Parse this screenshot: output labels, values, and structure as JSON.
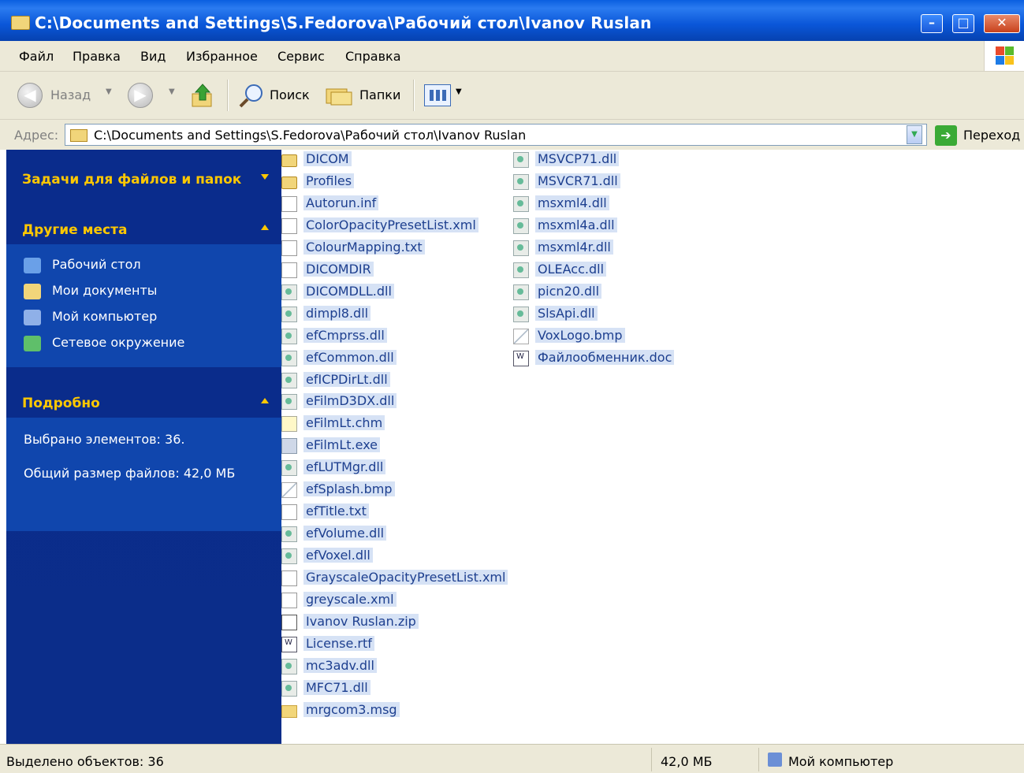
{
  "window": {
    "title": "C:\\Documents and Settings\\S.Fedorova\\Рабочий стол\\Ivanov Ruslan"
  },
  "menu": [
    "Файл",
    "Правка",
    "Вид",
    "Избранное",
    "Сервис",
    "Справка"
  ],
  "toolbar": {
    "back_label": "Назад",
    "search_label": "Поиск",
    "folders_label": "Папки"
  },
  "address": {
    "label": "Адрес:",
    "value": "C:\\Documents and Settings\\S.Fedorova\\Рабочий стол\\Ivanov Ruslan",
    "go_label": "Переход"
  },
  "sidebar": {
    "tasks_title": "Задачи для файлов и папок",
    "places_title": "Другие места",
    "places": [
      "Рабочий стол",
      "Мои документы",
      "Мой компьютер",
      "Сетевое окружение"
    ],
    "details_title": "Подробно",
    "selected_count": "Выбрано элементов: 36.",
    "total_size": "Общий размер файлов: 42,0 МБ"
  },
  "files": [
    {
      "name": "DICOM",
      "icon": "folder-icon"
    },
    {
      "name": "Profiles",
      "icon": "folder-icon"
    },
    {
      "name": "Autorun.inf",
      "icon": "inf-file-icon"
    },
    {
      "name": "ColorOpacityPresetList.xml",
      "icon": "xml-file-icon"
    },
    {
      "name": "ColourMapping.txt",
      "icon": "text-file-icon"
    },
    {
      "name": "DICOMDIR",
      "icon": "generic-file-icon"
    },
    {
      "name": "DICOMDLL.dll",
      "icon": "dll-file-icon"
    },
    {
      "name": "dimpl8.dll",
      "icon": "dll-file-icon"
    },
    {
      "name": "efCmprss.dll",
      "icon": "dll-file-icon"
    },
    {
      "name": "efCommon.dll",
      "icon": "dll-file-icon"
    },
    {
      "name": "efICPDirLt.dll",
      "icon": "dll-file-icon"
    },
    {
      "name": "eFilmD3DX.dll",
      "icon": "dll-file-icon"
    },
    {
      "name": "eFilmLt.chm",
      "icon": "help-file-icon"
    },
    {
      "name": "eFilmLt.exe",
      "icon": "exe-file-icon"
    },
    {
      "name": "efLUTMgr.dll",
      "icon": "dll-file-icon"
    },
    {
      "name": "efSplash.bmp",
      "icon": "bmp-file-icon"
    },
    {
      "name": "efTitle.txt",
      "icon": "text-file-icon"
    },
    {
      "name": "efVolume.dll",
      "icon": "dll-file-icon"
    },
    {
      "name": "efVoxel.dll",
      "icon": "dll-file-icon"
    },
    {
      "name": "GrayscaleOpacityPresetList.xml",
      "icon": "xml-file-icon"
    },
    {
      "name": "greyscale.xml",
      "icon": "xml-file-icon"
    },
    {
      "name": "Ivanov Ruslan.zip",
      "icon": "zip-file-icon"
    },
    {
      "name": "License.rtf",
      "icon": "rtf-file-icon"
    },
    {
      "name": "mc3adv.dll",
      "icon": "dll-file-icon"
    },
    {
      "name": "MFC71.dll",
      "icon": "dll-file-icon"
    },
    {
      "name": "mrgcom3.msg",
      "icon": "msg-file-icon"
    },
    {
      "name": "MSVCP71.dll",
      "icon": "dll-file-icon"
    },
    {
      "name": "MSVCR71.dll",
      "icon": "dll-file-icon"
    },
    {
      "name": "msxml4.dll",
      "icon": "dll-file-icon"
    },
    {
      "name": "msxml4a.dll",
      "icon": "dll-file-icon"
    },
    {
      "name": "msxml4r.dll",
      "icon": "dll-file-icon"
    },
    {
      "name": "OLEAcc.dll",
      "icon": "dll-file-icon"
    },
    {
      "name": "picn20.dll",
      "icon": "dll-file-icon"
    },
    {
      "name": "SlsApi.dll",
      "icon": "dll-file-icon"
    },
    {
      "name": "VoxLogo.bmp",
      "icon": "bmp-file-icon"
    },
    {
      "name": "Файлообменник.doc",
      "icon": "doc-file-icon"
    }
  ],
  "status": {
    "selected": "Выделено объектов: 36",
    "size": "42,0 МБ",
    "location": "Мой компьютер"
  }
}
